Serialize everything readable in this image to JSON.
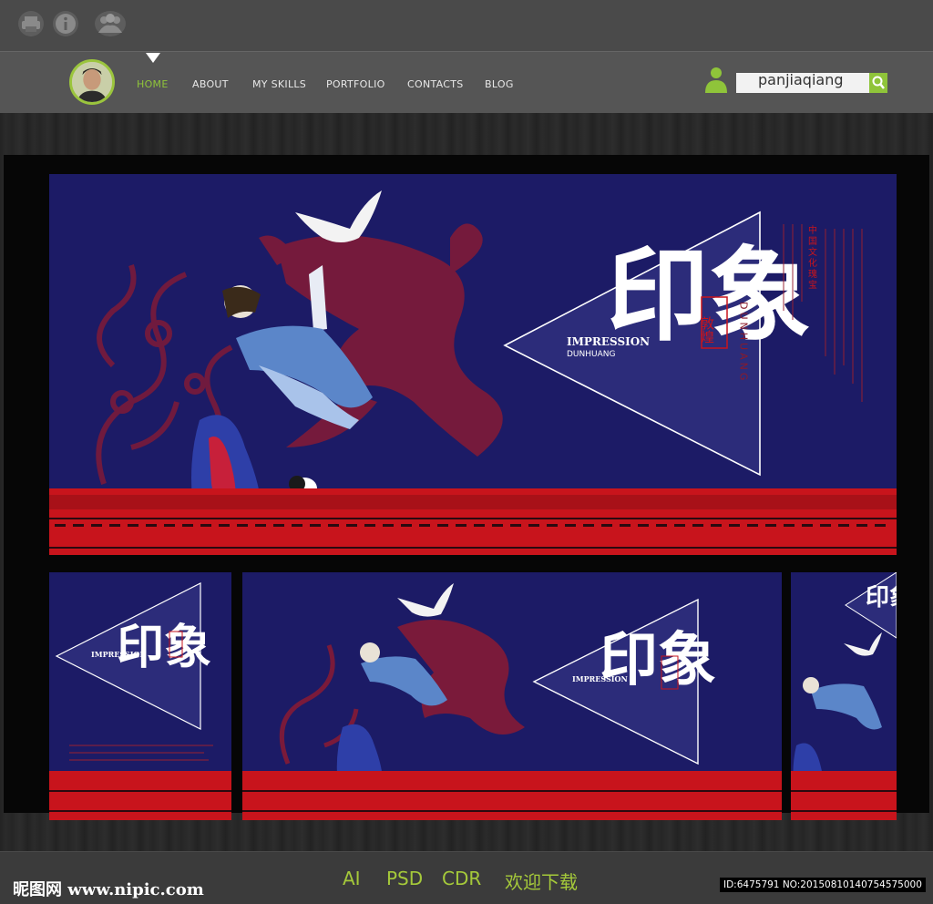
{
  "nav": {
    "items": [
      "HOME",
      "ABOUT",
      "MY SKILLS",
      "PORTFOLIO",
      "CONTACTS",
      "BLOG"
    ],
    "active": "HOME",
    "username": "panjiaqiang"
  },
  "poster": {
    "big_chars": "印象",
    "seal_text": "敦煌",
    "title_en": "IMPRESSION",
    "subtitle_en": "DUNHUANG",
    "vertical_en": "DUNHUANG",
    "vertical_cn": "中国文化瑰宝"
  },
  "footer": {
    "watermark": "昵图网 www.nipic.com",
    "formats": [
      "AI",
      "PSD",
      "CDR",
      "欢迎下载"
    ],
    "id_line": "ID:6475791 NO:20150810140754575000"
  },
  "colors": {
    "accent_green": "#8fc43a",
    "poster_navy": "#1c1b66",
    "pattern_red": "#c8141c",
    "phoenix_red": "#7a1a3a"
  }
}
